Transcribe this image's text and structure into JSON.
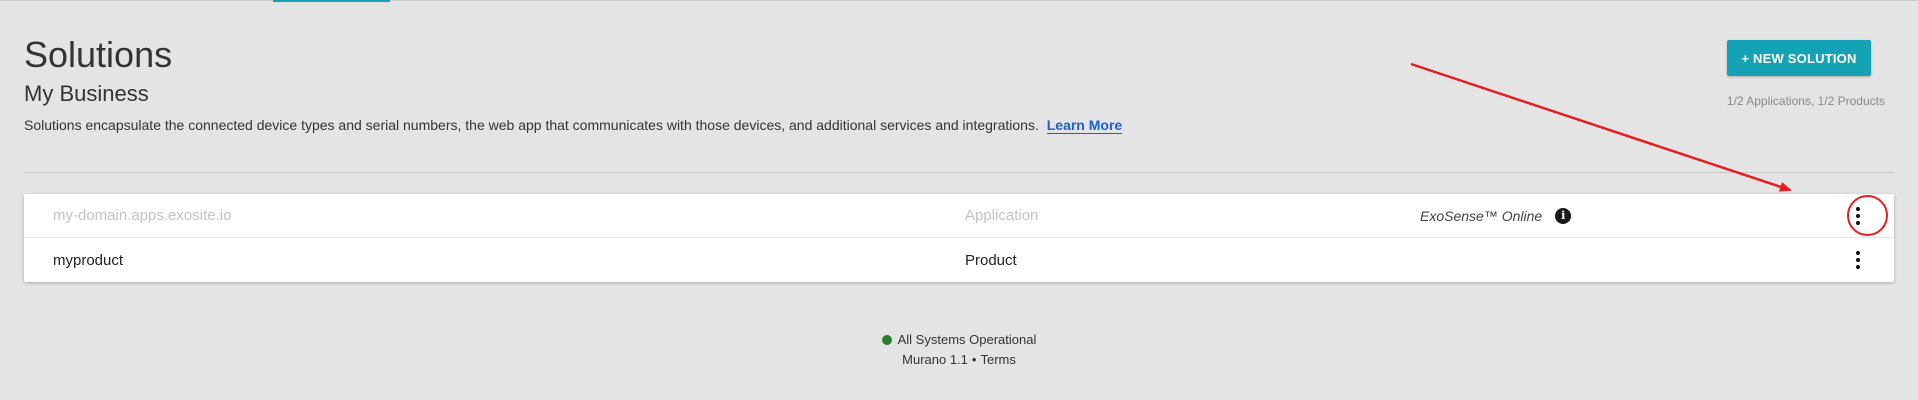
{
  "header": {
    "title": "Solutions",
    "subtitle": "My Business",
    "description": "Solutions encapsulate the connected device types and serial numbers, the web app that communicates with those devices, and additional services and integrations.",
    "learn_more": "Learn More",
    "new_solution_label": "+ NEW SOLUTION",
    "quota": "1/2 Applications, 1/2 Products"
  },
  "solutions": [
    {
      "name": "my-domain.apps.exosite.io",
      "type": "Application",
      "service": "ExoSense™ Online",
      "info_icon": "i",
      "muted": true
    },
    {
      "name": "myproduct",
      "type": "Product",
      "service": "",
      "muted": false
    }
  ],
  "footer": {
    "status": "All Systems Operational",
    "version": "Murano 1.1",
    "separator": "•",
    "terms": "Terms"
  },
  "colors": {
    "accent": "#14a3b4",
    "link": "#1a5fd6",
    "status_ok": "#2e7d32",
    "annotation": "#e02020"
  },
  "icons": {
    "row_menu": "vertical-ellipsis-icon",
    "info": "info-icon",
    "status": "status-dot-icon"
  }
}
